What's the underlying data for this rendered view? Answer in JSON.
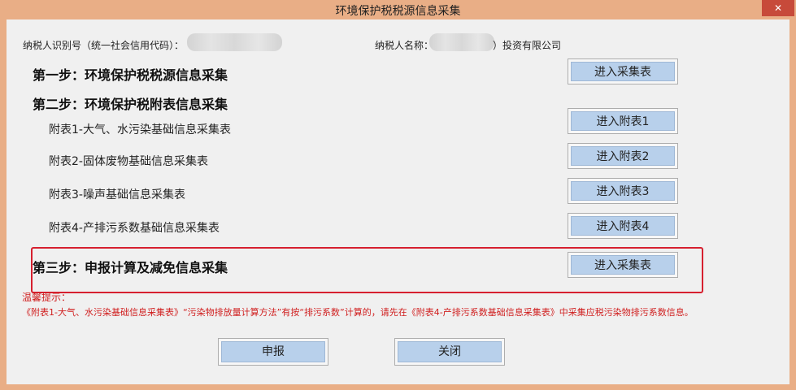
{
  "window": {
    "title": "环境保护税税源信息采集",
    "close_label": "✕"
  },
  "taxpayer": {
    "id_label": "纳税人识别号（统一社会信用代码）：",
    "name_label": "纳税人名称：",
    "name_suffix": "）投资有限公司"
  },
  "steps": {
    "step1": {
      "label": "第一步：环境保护税税源信息采集",
      "button": "进入采集表"
    },
    "step2": {
      "label": "第二步：环境保护税附表信息采集"
    },
    "step3": {
      "label": "第三步：申报计算及减免信息采集",
      "button": "进入采集表"
    }
  },
  "attachments": [
    {
      "label": "附表1-大气、水污染基础信息采集表",
      "button": "进入附表1"
    },
    {
      "label": "附表2-固体废物基础信息采集表",
      "button": "进入附表2"
    },
    {
      "label": "附表3-噪声基础信息采集表",
      "button": "进入附表3"
    },
    {
      "label": "附表4-产排污系数基础信息采集表",
      "button": "进入附表4"
    }
  ],
  "hint": {
    "title": "温馨提示：",
    "text": "《附表1-大气、水污染基础信息采集表》“污染物排放量计算方法”有按“排污系数”计算的，请先在《附表4-产排污系数基础信息采集表》中采集应税污染物排污系数信息。"
  },
  "footer": {
    "submit_label": "申报",
    "close_label": "关闭"
  },
  "colors": {
    "titlebar": "#e9ae86",
    "button_face": "#b8d0eb",
    "highlight": "#d6202f",
    "hint": "#d01f1f"
  }
}
